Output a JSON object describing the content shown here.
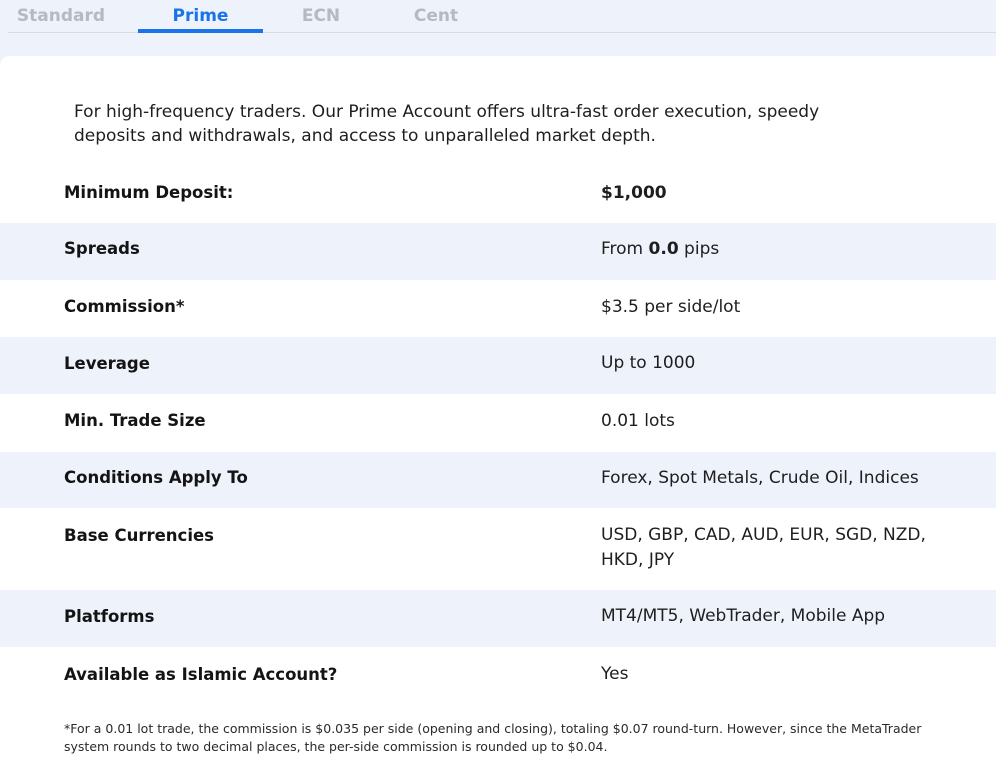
{
  "tabs": [
    {
      "label": "Standard",
      "active": false
    },
    {
      "label": "Prime",
      "active": true
    },
    {
      "label": "ECN",
      "active": false
    },
    {
      "label": "Cent",
      "active": false
    }
  ],
  "accent_color": "#1a73e8",
  "intro": "For high-frequency traders. Our Prime Account offers ultra-fast order execution, speedy deposits and withdrawals, and access to unparalleled market depth.",
  "rows": [
    {
      "label": "Minimum Deposit:",
      "value": "$1,000"
    },
    {
      "label": "Spreads",
      "value_prefix": "From ",
      "value_bold": "0.0",
      "value_suffix": " pips"
    },
    {
      "label": "Commission*",
      "value": "$3.5 per side/lot"
    },
    {
      "label": "Leverage",
      "value": "Up to 1000"
    },
    {
      "label": "Min. Trade Size",
      "value": "0.01 lots"
    },
    {
      "label": "Conditions Apply To",
      "value": "Forex, Spot Metals, Crude Oil, Indices"
    },
    {
      "label": "Base Currencies",
      "value": "USD, GBP, CAD, AUD, EUR, SGD, NZD, HKD, JPY"
    },
    {
      "label": "Platforms",
      "value": "MT4/MT5, WebTrader, Mobile App"
    },
    {
      "label": "Available as Islamic Account?",
      "value": "Yes"
    }
  ],
  "footnote": "*For a 0.01 lot trade, the commission is $0.035 per side (opening and closing), totaling $0.07 round-turn. However, since the MetaTrader system rounds to two decimal places, the per-side commission is rounded up to $0.04."
}
